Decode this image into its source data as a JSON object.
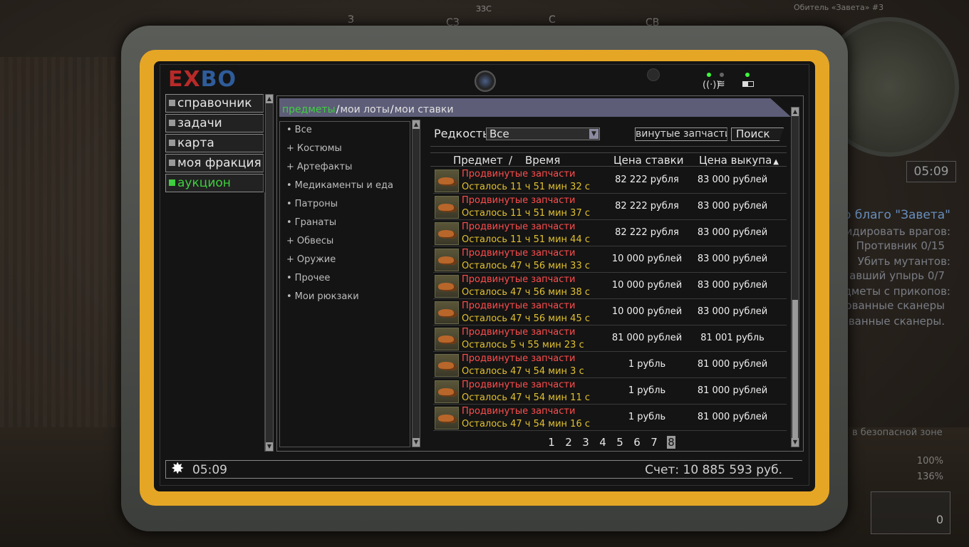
{
  "hud": {
    "compass": [
      "З",
      "ЗЗС",
      "СЗ",
      "С",
      "СВ"
    ],
    "title": "Обитель «Завета» #3",
    "time": "05:09",
    "quest_title": "о благо \"Завета\"",
    "quest_lines": [
      "квидировать врагов:",
      "Противник 0/15",
      "Убить мутантов:",
      "авший упырь 0/7",
      "редметы с прикопов:",
      "ованные сканеры",
      "ованные сканеры."
    ],
    "safe_zone": "в безопасной зоне",
    "hp": "100%",
    "stamina": "136%",
    "ammo": "0"
  },
  "logo": {
    "part1": "EX",
    "part2": "BO"
  },
  "sidebar": {
    "items": [
      {
        "label": "справочник",
        "active": false
      },
      {
        "label": "задачи",
        "active": false
      },
      {
        "label": "карта",
        "active": false
      },
      {
        "label": "моя фракция",
        "active": false
      },
      {
        "label": "аукцион",
        "active": true
      }
    ]
  },
  "tabs": [
    "предметы",
    "мои лоты",
    "мои ставки"
  ],
  "categories": [
    {
      "marker": "•",
      "label": "Все"
    },
    {
      "marker": "+",
      "label": "Костюмы"
    },
    {
      "marker": "+",
      "label": "Артефакты"
    },
    {
      "marker": "•",
      "label": "Медикаменты и еда"
    },
    {
      "marker": "•",
      "label": "Патроны"
    },
    {
      "marker": "•",
      "label": "Гранаты"
    },
    {
      "marker": "+",
      "label": "Обвесы"
    },
    {
      "marker": "+",
      "label": "Оружие"
    },
    {
      "marker": "•",
      "label": "Прочее"
    },
    {
      "marker": "•",
      "label": "Мои рюкзаки"
    }
  ],
  "filter": {
    "rarity_label": "Редкость",
    "rarity_value": "Все",
    "search_value": "винутые запчасти",
    "search_button": "Поиск"
  },
  "columns": {
    "item": "Предмет",
    "sep": "/",
    "time": "Время",
    "bid": "Цена ставки",
    "buyout": "Цена выкупа",
    "sort_arrow": "▲"
  },
  "lots": [
    {
      "name": "Продвинутые запчасти",
      "time": "Осталось 11 ч 51 мин 32 с",
      "bid": "82 222 рубля",
      "buyout": "83 000 рублей"
    },
    {
      "name": "Продвинутые запчасти",
      "time": "Осталось 11 ч 51 мин 37 с",
      "bid": "82 222 рубля",
      "buyout": "83 000 рублей"
    },
    {
      "name": "Продвинутые запчасти",
      "time": "Осталось 11 ч 51 мин 44 с",
      "bid": "82 222 рубля",
      "buyout": "83 000 рублей"
    },
    {
      "name": "Продвинутые запчасти",
      "time": "Осталось 47 ч 56 мин 33 с",
      "bid": "10 000 рублей",
      "buyout": "83 000 рублей"
    },
    {
      "name": "Продвинутые запчасти",
      "time": "Осталось 47 ч 56 мин 38 с",
      "bid": "10 000 рублей",
      "buyout": "83 000 рублей"
    },
    {
      "name": "Продвинутые запчасти",
      "time": "Осталось 47 ч 56 мин 45 с",
      "bid": "10 000 рублей",
      "buyout": "83 000 рублей"
    },
    {
      "name": "Продвинутые запчасти",
      "time": "Осталось 5 ч 55 мин 23 с",
      "bid": "81 000 рублей",
      "buyout": "81 001 рубль"
    },
    {
      "name": "Продвинутые запчасти",
      "time": "Осталось 47 ч 54 мин 3 с",
      "bid": "1 рубль",
      "buyout": "81 000 рублей"
    },
    {
      "name": "Продвинутые запчасти",
      "time": "Осталось 47 ч 54 мин 11 с",
      "bid": "1 рубль",
      "buyout": "81 000 рублей"
    },
    {
      "name": "Продвинутые запчасти",
      "time": "Осталось 47 ч 54 мин 16 с",
      "bid": "1 рубль",
      "buyout": "81 000 рублей"
    }
  ],
  "pagination": {
    "pages": [
      "1",
      "2",
      "3",
      "4",
      "5",
      "6",
      "7",
      "8"
    ],
    "current": "8"
  },
  "footer": {
    "time": "05:09",
    "balance": "Счет: 10 885 593 руб."
  },
  "colors": {
    "frame": "#e6a625",
    "active": "#3fcf3f",
    "item_name": "#ff4d4d",
    "item_time": "#e0c030",
    "tab_bar": "#5d5d78"
  }
}
